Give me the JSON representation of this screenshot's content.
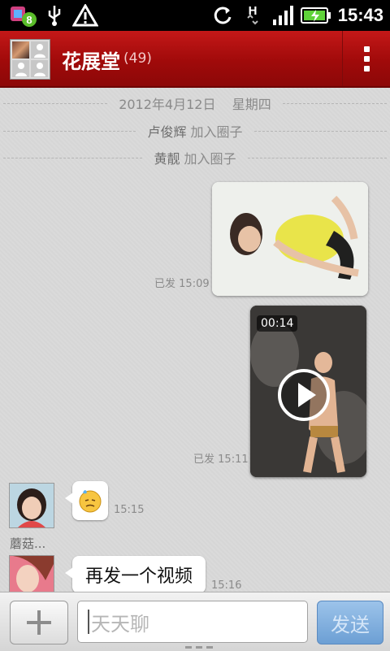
{
  "status_bar": {
    "time": "15:43",
    "notification_badge": "8",
    "network": "H",
    "icons": [
      "app-notification-icon",
      "usb-icon",
      "warning-icon",
      "sync-icon",
      "network-h-icon",
      "signal-icon",
      "battery-charging-icon"
    ]
  },
  "header": {
    "title": "花展堂",
    "member_count": "(49)",
    "menu": "overflow-menu-icon"
  },
  "chat": {
    "date_line": {
      "date": "2012年4月12日",
      "weekday": "星期四"
    },
    "join_events": [
      {
        "name": "卢俊辉",
        "action": "加入圈子"
      },
      {
        "name": "黄靓",
        "action": "加入圈子"
      }
    ],
    "messages": [
      {
        "type": "image",
        "direction": "out",
        "status": "已发",
        "time": "15:09"
      },
      {
        "type": "video",
        "direction": "out",
        "duration": "00:14",
        "status": "已发",
        "time": "15:11"
      },
      {
        "type": "emoji",
        "direction": "in",
        "sender": "蘑菇...",
        "emoji": "sweat-face",
        "time": "15:15"
      },
      {
        "type": "text",
        "direction": "in",
        "text": "再发一个视频",
        "time": "15:16"
      }
    ]
  },
  "input_bar": {
    "placeholder": "天天聊",
    "send_label": "发送"
  },
  "colors": {
    "header_red": "#a00a0a",
    "send_blue": "#6c9fd4",
    "chat_bg": "#d8d8d8"
  }
}
